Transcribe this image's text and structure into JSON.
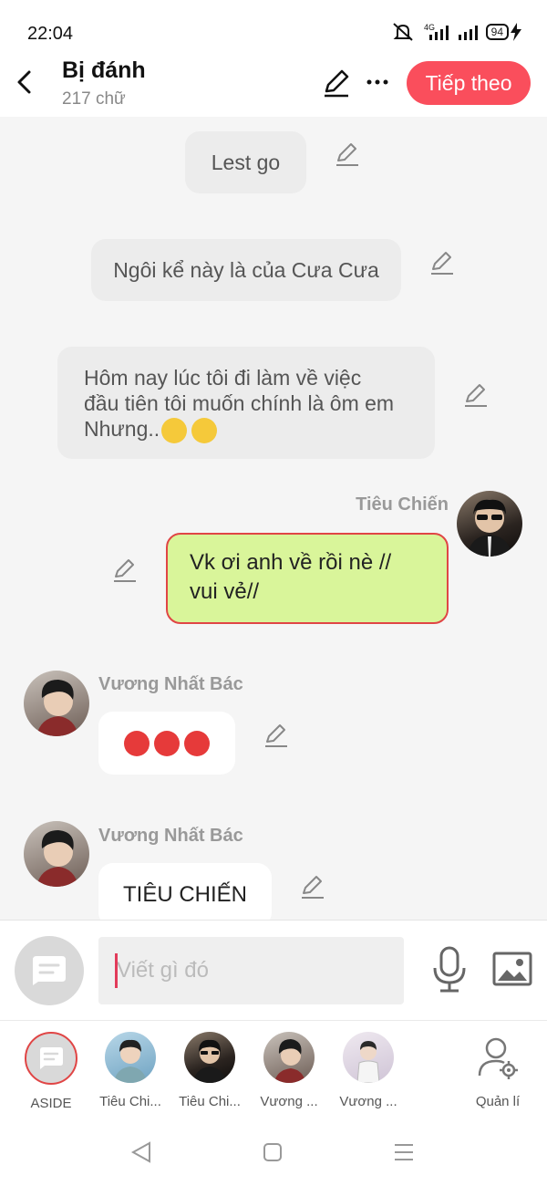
{
  "status_bar": {
    "time": "22:04",
    "network": "4G",
    "battery": "94"
  },
  "header": {
    "title": "Bị đánh",
    "subtitle": "217 chữ",
    "next_label": "Tiếp theo"
  },
  "messages": [
    {
      "text": "Lest go"
    },
    {
      "text": "Ngôi kể này là của Cưa Cưa"
    },
    {
      "text_lines": [
        "Hôm nay lúc tôi đi làm về việc",
        "đầu tiên tôi muốn chính là ôm em",
        "Nhưng.."
      ],
      "emoji": [
        "sad-sweat-emoji",
        "sad-sweat-emoji"
      ]
    },
    {
      "speaker": "Tiêu Chiến",
      "text_lines": [
        "Vk ơi anh về rồi nè //",
        "vui vẻ//"
      ]
    },
    {
      "speaker": "Vương Nhất Bác",
      "emoji": [
        "angry-emoji",
        "angry-emoji",
        "angry-emoji"
      ]
    },
    {
      "speaker": "Vương Nhất Bác",
      "text": "TIÊU CHIẾN"
    }
  ],
  "input": {
    "placeholder": "Viết gì đó"
  },
  "characters": [
    {
      "label": "ASIDE"
    },
    {
      "label": "Tiêu Chi..."
    },
    {
      "label": "Tiêu Chi..."
    },
    {
      "label": "Vương ..."
    },
    {
      "label": "Vương ..."
    },
    {
      "label": "Quản lí"
    }
  ],
  "colors": {
    "accent": "#fa4e5c",
    "highlight_bubble": "#d9f59a",
    "highlight_border": "#e04545"
  }
}
